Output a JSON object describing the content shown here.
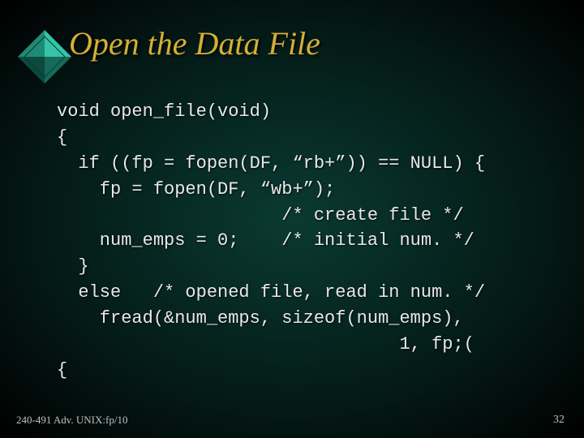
{
  "title": "Open the Data File",
  "code": "void open_file(void)\n{\n  if ((fp = fopen(DF, “rb+”)) == NULL) {\n    fp = fopen(DF, “wb+”);\n                     /* create file */\n    num_emps = 0;    /* initial num. */\n  }\n  else   /* opened file, read in num. */\n    fread(&num_emps, sizeof(num_emps),\n                                1, fp;(\n{",
  "footer_left": "240-491 Adv. UNIX:fp/10",
  "footer_right": "32",
  "colors": {
    "title": "#d4af37",
    "text": "#e8e8e8",
    "bullet_light": "#2ea893",
    "bullet_dark": "#0b4a3f"
  }
}
